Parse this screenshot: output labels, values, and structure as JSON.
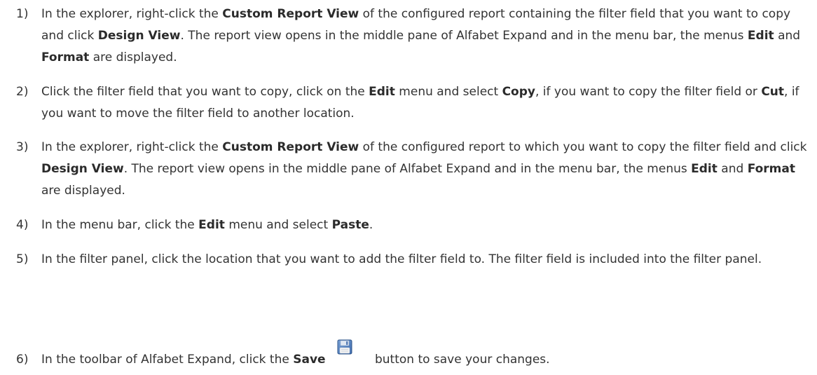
{
  "steps": [
    {
      "number": "1)",
      "parts": [
        "In the explorer, right-click the ",
        "Custom Report View",
        " of the configured report containing the filter field that you want to copy and click ",
        "Design View",
        ". The report view opens in the middle pane of Alfabet Expand and in the menu bar, the menus ",
        "Edit",
        " and ",
        "Format",
        " are displayed."
      ]
    },
    {
      "number": "2)",
      "parts": [
        "Click the filter field that you want to copy, click on the ",
        "Edit",
        " menu and select ",
        "Copy",
        ", if you want to copy the filter field or ",
        "Cut",
        ", if you want to move the filter field to another location."
      ]
    },
    {
      "number": "3)",
      "parts": [
        "In the explorer, right-click the ",
        "Custom Report View",
        " of the configured report to which you want to copy the filter field and click ",
        "Design View",
        ". The report view opens in the middle pane of Alfabet Expand and in the menu bar, the menus ",
        "Edit",
        " and ",
        "Format",
        " are displayed."
      ]
    },
    {
      "number": "4)",
      "parts": [
        "In the menu bar, click the ",
        "Edit",
        " menu and select ",
        "Paste",
        "."
      ]
    },
    {
      "number": "5)",
      "parts": [
        "In the filter panel, click the location that you want to add the filter field to. The filter field is included into the filter panel."
      ]
    },
    {
      "number": "6)",
      "parts": [
        "In the toolbar of Alfabet Expand, click the ",
        "Save",
        " button to save your changes."
      ],
      "icon": "save-icon"
    }
  ]
}
